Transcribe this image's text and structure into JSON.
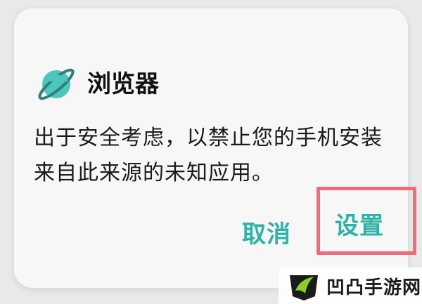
{
  "dialog": {
    "app_name": "浏览器",
    "app_icon": "planet-ring-icon",
    "message_line1": "出于安全考虑，以禁止您的手机安装",
    "message_line2": "来自此来源的未知应用。",
    "buttons": {
      "cancel_label": "取消",
      "settings_label": "设置"
    }
  },
  "watermark": {
    "text": "凹凸手游网",
    "logo": "game-logo"
  },
  "colors": {
    "accent": "#2db3a5",
    "highlight": "#f06a7a",
    "icon_teal": "#4cc7bb",
    "icon_ring": "#2f7f7a",
    "logo_green": "#8ccd2a"
  }
}
